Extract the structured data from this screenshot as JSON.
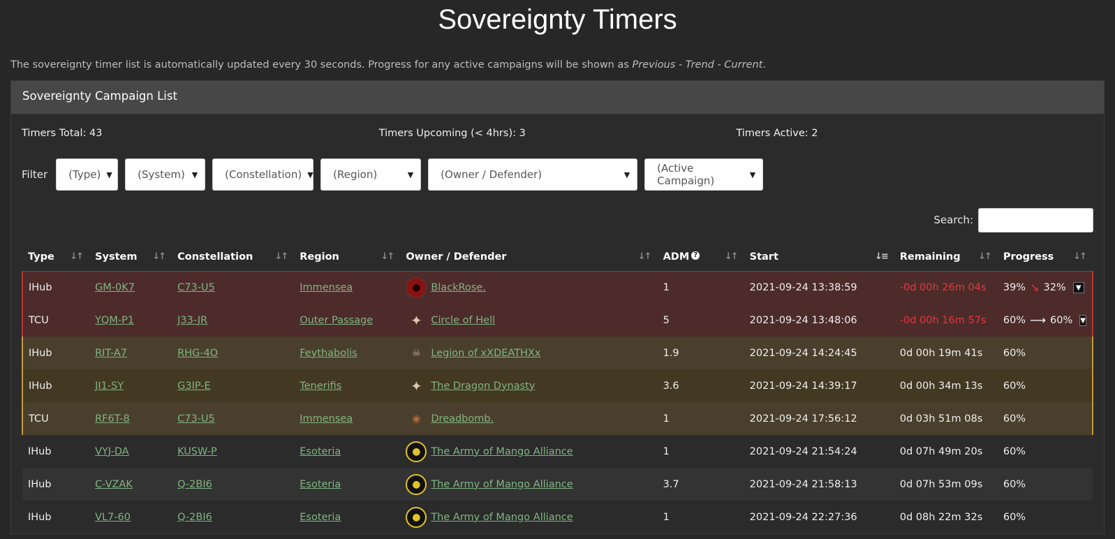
{
  "title": "Sovereignty Timers",
  "intro": {
    "text": "The sovereignty timer list is automatically updated every 30 seconds. Progress for any active campaigns will be shown as ",
    "format": "Previous - Trend - Current",
    "end": "."
  },
  "panel": {
    "heading": "Sovereignty Campaign List",
    "stats": {
      "total": "Timers Total: 43",
      "upcoming": "Timers Upcoming (< 4hrs): 3",
      "active": "Timers Active: 2"
    },
    "filter_label": "Filter",
    "filters": [
      "(Type)",
      "(System)",
      "(Constellation)",
      "(Region)",
      "(Owner / Defender)",
      "(Active Campaign)"
    ],
    "search_label": "Search:",
    "search_value": ""
  },
  "table": {
    "headers": [
      "Type",
      "System",
      "Constellation",
      "Region",
      "Owner / Defender",
      "ADM",
      "Start",
      "Remaining",
      "Progress"
    ],
    "adm_help_icon": "?",
    "rows": [
      {
        "type": "IHub",
        "system": "GM-0K7",
        "constellation": "C73-U5",
        "region": "Immensea",
        "owner": "BlackRose.",
        "logo": "red",
        "adm": "1",
        "start": "2021-09-24 13:38:59",
        "remaining": "-0d 00h 26m 04s",
        "progress_prev": "39%",
        "trend": "↘",
        "progress_cur": "32%"
      },
      {
        "type": "TCU",
        "system": "YQM-P1",
        "constellation": "J33-JR",
        "region": "Outer Passage",
        "owner": "Circle of Hell",
        "logo": "star",
        "adm": "5",
        "start": "2021-09-24 13:48:06",
        "remaining": "-0d 00h 16m 57s",
        "progress_prev": "60%",
        "trend": "⟶",
        "progress_cur": "60%"
      },
      {
        "type": "IHub",
        "system": "RIT-A7",
        "constellation": "RHG-4O",
        "region": "Feythabolis",
        "owner": "Legion of xXDEATHXx",
        "logo": "skull",
        "adm": "1.9",
        "start": "2021-09-24 14:24:45",
        "remaining": "0d 00h 19m 41s",
        "progress": "60%"
      },
      {
        "type": "IHub",
        "system": "JI1-SY",
        "constellation": "G3IP-E",
        "region": "Tenerifis",
        "owner": "The Dragon Dynasty",
        "logo": "star",
        "adm": "3.6",
        "start": "2021-09-24 14:39:17",
        "remaining": "0d 00h 34m 13s",
        "progress": "60%"
      },
      {
        "type": "TCU",
        "system": "RF6T-8",
        "constellation": "C73-U5",
        "region": "Immensea",
        "owner": "Dreadbomb.",
        "logo": "bomb",
        "adm": "1",
        "start": "2021-09-24 17:56:12",
        "remaining": "0d 03h 51m 08s",
        "progress": "60%"
      },
      {
        "type": "IHub",
        "system": "VYJ-DA",
        "constellation": "KUSW-P",
        "region": "Esoteria",
        "owner": "The Army of Mango Alliance",
        "logo": "mango",
        "adm": "1",
        "start": "2021-09-24 21:54:24",
        "remaining": "0d 07h 49m 20s",
        "progress": "60%"
      },
      {
        "type": "IHub",
        "system": "C-VZAK",
        "constellation": "Q-2BI6",
        "region": "Esoteria",
        "owner": "The Army of Mango Alliance",
        "logo": "mango",
        "adm": "3.7",
        "start": "2021-09-24 21:58:13",
        "remaining": "0d 07h 53m 09s",
        "progress": "60%"
      },
      {
        "type": "IHub",
        "system": "VL7-60",
        "constellation": "Q-2BI6",
        "region": "Esoteria",
        "owner": "The Army of Mango Alliance",
        "logo": "mango",
        "adm": "1",
        "start": "2021-09-24 22:27:36",
        "remaining": "0d 08h 22m 32s",
        "progress": "60%"
      }
    ]
  }
}
